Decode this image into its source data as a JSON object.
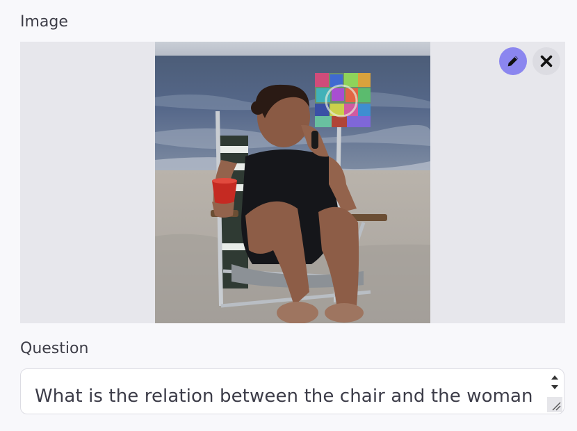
{
  "image_section": {
    "label": "Image",
    "edit_icon": "pencil-icon",
    "remove_icon": "close-icon",
    "accent_color": "#8b86ef"
  },
  "question_section": {
    "label": "Question",
    "value": "What is the relation between the chair and the woman"
  }
}
